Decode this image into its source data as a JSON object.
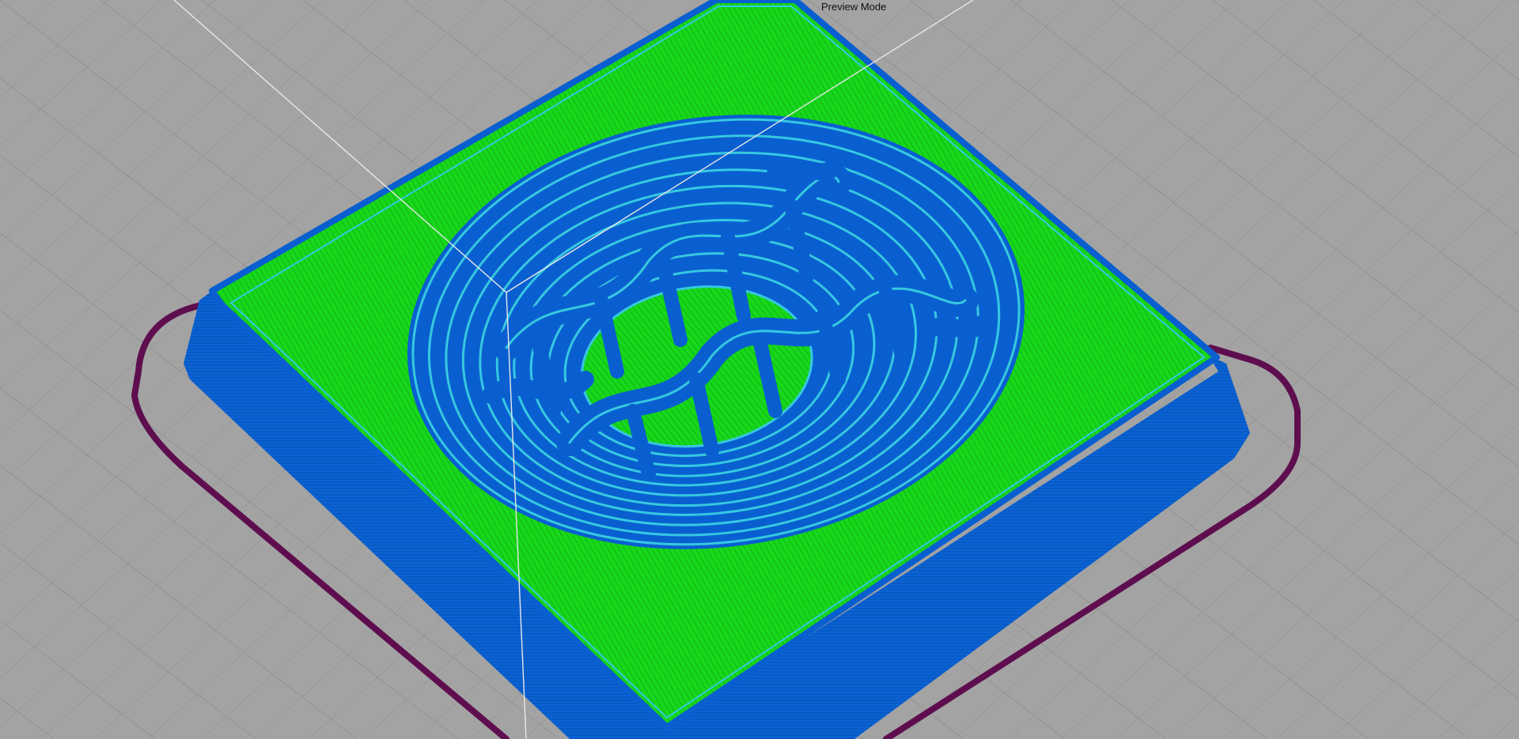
{
  "viewport": {
    "mode_label": "Preview Mode"
  },
  "colors": {
    "background": "#a3a3a3",
    "grid_line": "#8c8c8c",
    "build_plate_outline": "#5e0e4e",
    "perimeter_wall": "#0a5fd0",
    "top_infill": "#17d81a",
    "inner_perimeter_highlight": "#36c8e0",
    "axis_line": "#e8e8e8"
  },
  "icons": {
    "embossed_text": "wavy-text-relief-icon"
  }
}
